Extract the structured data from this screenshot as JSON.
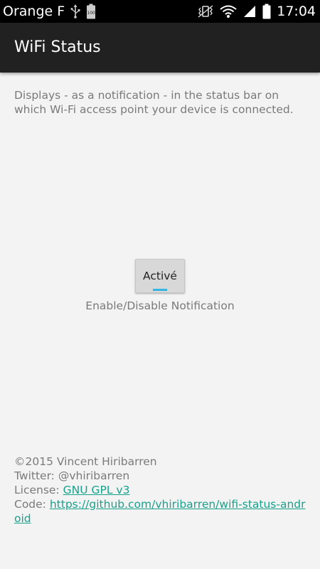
{
  "status_bar": {
    "carrier": "Orange F",
    "battery_level": "100",
    "time": "17:04",
    "icons": [
      "usb-icon",
      "battery-icon",
      "vibrate-icon",
      "wifi-icon",
      "signal-icon",
      "battery-icon"
    ]
  },
  "app_bar": {
    "title": "WiFi Status"
  },
  "main": {
    "description": "Displays - as a notification - in the status bar on which Wi-Fi access point your device is connected.",
    "toggle": {
      "label": "Activé",
      "state": "on",
      "caption": "Enable/Disable Notification"
    }
  },
  "footer": {
    "copyright": "©2015 Vincent Hiribarren",
    "twitter": "Twitter: @vhiribarren",
    "license_prefix": "License: ",
    "license_link": "GNU GPL v3",
    "code_prefix": "Code: ",
    "code_link": "https://github.com/vhiribarren/wifi-status-android"
  },
  "colors": {
    "status_bar_bg": "#000000",
    "action_bar_bg": "#212121",
    "background": "#f3f3f3",
    "text_gray": "#7a7a7a",
    "link": "#18a18a",
    "toggle_indicator": "#33b5e5"
  }
}
